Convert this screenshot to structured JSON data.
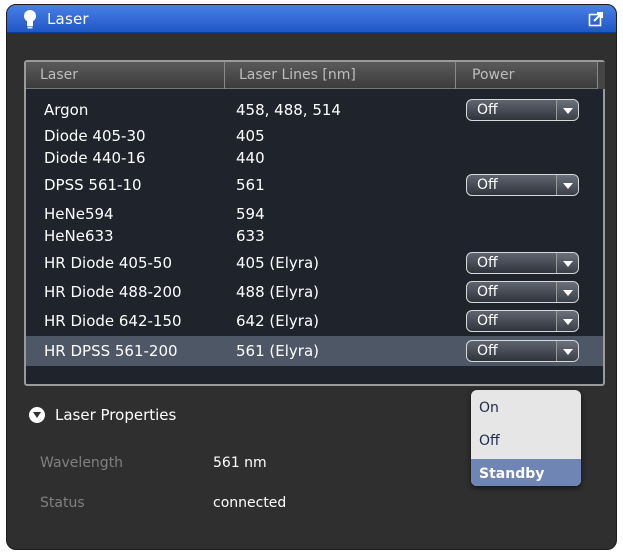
{
  "window": {
    "title": "Laser"
  },
  "table": {
    "columns": [
      "Laser",
      "Laser Lines [nm]",
      "Power"
    ],
    "rows": [
      {
        "name": "Argon",
        "lines": "458, 488, 514",
        "power": "Off"
      },
      {
        "name": "Diode 405-30",
        "lines": "405",
        "power": null
      },
      {
        "name": "Diode 440-16",
        "lines": "440",
        "power": null
      },
      {
        "name": "DPSS 561-10",
        "lines": "561",
        "power": "Off"
      },
      {
        "name": "HeNe594",
        "lines": "594",
        "power": null
      },
      {
        "name": "HeNe633",
        "lines": "633",
        "power": null
      },
      {
        "name": "HR Diode 405-50",
        "lines": "405 (Elyra)",
        "power": "Off"
      },
      {
        "name": "HR Diode 488-200",
        "lines": "488 (Elyra)",
        "power": "Off"
      },
      {
        "name": "HR Diode 642-150",
        "lines": "642 (Elyra)",
        "power": "Off"
      },
      {
        "name": "HR DPSS 561-200",
        "lines": "561 (Elyra)",
        "power": "Off",
        "selected": true
      }
    ]
  },
  "power_dropdown": {
    "options": [
      "On",
      "Off",
      "Standby"
    ],
    "highlighted": "Standby"
  },
  "properties": {
    "header": "Laser Properties",
    "wavelength_label": "Wavelength",
    "wavelength_value": "561 nm",
    "status_label": "Status",
    "status_value": "connected"
  },
  "colors": {
    "titlebar": "#2d64d6",
    "panel_bg": "#2f2f2f",
    "table_bg": "#1f232b",
    "selected_row": "#4e5766",
    "dropdown_highlight": "#6f85b3"
  },
  "icons": {
    "title_icon": "lightbulb-icon",
    "undock_icon": "undock-icon"
  }
}
